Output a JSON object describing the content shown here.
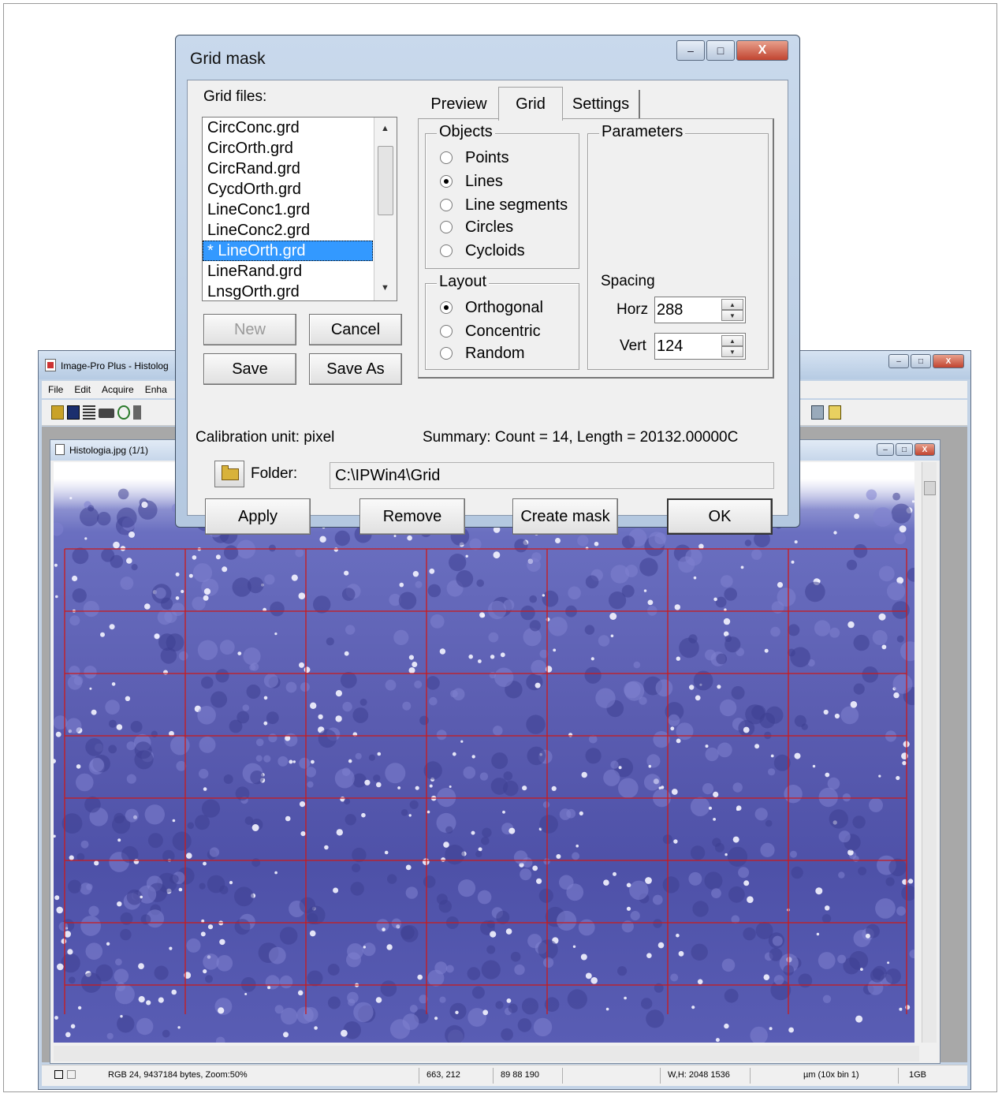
{
  "app": {
    "title": "Image-Pro Plus - Histolog",
    "menu": [
      "File",
      "Edit",
      "Acquire",
      "Enha"
    ],
    "child_title": "Histologia.jpg (1/1)",
    "status": {
      "info": "RGB 24, 9437184 bytes, Zoom:50%",
      "coords": "663, 212",
      "rgb": "89 88 190",
      "wh": "W,H: 2048 1536",
      "unit": "µm (10x bin 1)",
      "mem": "1GB"
    },
    "caption_min": "–",
    "caption_max": "□",
    "caption_close": "X"
  },
  "dialog": {
    "title": "Grid mask",
    "caption_min": "–",
    "caption_max": "□",
    "caption_close": "X",
    "grid_files_label": "Grid files:",
    "grid_files": [
      "CircConc.grd",
      "CircOrth.grd",
      "CircRand.grd",
      "CycdOrth.grd",
      "LineConc1.grd",
      "LineConc2.grd",
      "* LineOrth.grd",
      "LineRand.grd",
      "LnsgOrth.grd"
    ],
    "selected_file": "* LineOrth.grd",
    "buttons": {
      "new": "New",
      "cancel": "Cancel",
      "save": "Save",
      "save_as": "Save As",
      "apply": "Apply",
      "remove": "Remove",
      "create_mask": "Create mask",
      "ok": "OK"
    },
    "tabs": {
      "preview": "Preview",
      "grid": "Grid",
      "settings": "Settings"
    },
    "active_tab": "Grid",
    "objects": {
      "legend": "Objects",
      "points": "Points",
      "lines": "Lines",
      "line_segments": "Line segments",
      "circles": "Circles",
      "cycloids": "Cycloids",
      "selected": "Lines"
    },
    "layout": {
      "legend": "Layout",
      "orthogonal": "Orthogonal",
      "concentric": "Concentric",
      "random": "Random",
      "selected": "Orthogonal"
    },
    "parameters": {
      "legend": "Parameters",
      "spacing_label": "Spacing",
      "horz_label": "Horz",
      "horz_value": "288",
      "vert_label": "Vert",
      "vert_value": "124"
    },
    "calibration": "Calibration unit: pixel",
    "summary": "Summary: Count = 14,  Length = 20132.00000C",
    "folder_label": "Folder:",
    "folder_value": "C:\\IPWin4\\Grid"
  },
  "colors": {
    "selection": "#3399ff",
    "grid_line": "#cc1a1a",
    "tissue": "#5a5cb0"
  }
}
